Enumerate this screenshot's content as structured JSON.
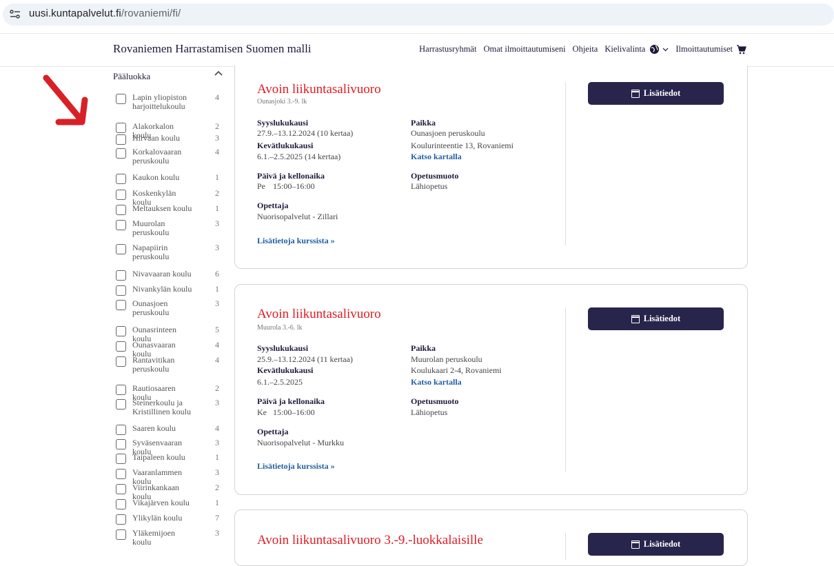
{
  "browser": {
    "url_host": "uusi.kuntapalvelut.fi",
    "url_path": "/rovaniemi/fi/"
  },
  "header": {
    "brand": "Rovaniemen Harrastamisen Suomen malli",
    "nav": {
      "groups": "Harrastusryhmät",
      "my": "Omat ilmoittautumiseni",
      "help": "Ohjeita",
      "lang": "Kielivalinta",
      "cart": "Ilmoittautumiset"
    }
  },
  "sidebar": {
    "heading": "Pääluokka",
    "items": [
      {
        "label": "Lapin yliopiston harjoittelukoulu",
        "count": "4"
      },
      {
        "label": "Alakorkalon koulu",
        "count": "2"
      },
      {
        "label": "Hirvaan koulu",
        "count": "3"
      },
      {
        "label": "Korkalovaaran peruskoulu",
        "count": "4"
      },
      {
        "label": "Kaukon koulu",
        "count": "1"
      },
      {
        "label": "Koskenkylän koulu",
        "count": "2"
      },
      {
        "label": "Meltauksen koulu",
        "count": "1"
      },
      {
        "label": "Muurolan peruskoulu",
        "count": "3"
      },
      {
        "label": "Napapiirin peruskoulu",
        "count": "3"
      },
      {
        "label": "Nivavaaran koulu",
        "count": "6"
      },
      {
        "label": "Nivankylän koulu",
        "count": "1"
      },
      {
        "label": "Ounasjoen peruskoulu",
        "count": "3"
      },
      {
        "label": "Ounasrinteen koulu",
        "count": "5"
      },
      {
        "label": "Ounasvaaran koulu",
        "count": "4"
      },
      {
        "label": "Rantavitikan peruskoulu",
        "count": "4"
      },
      {
        "label": "Rautiosaaren koulu",
        "count": "2"
      },
      {
        "label": "Steinerkoulu ja Kristillinen koulu",
        "count": "3"
      },
      {
        "label": "Saaren koulu",
        "count": "4"
      },
      {
        "label": "Syväsenvaaran koulu",
        "count": "3"
      },
      {
        "label": "Taipaleen koulu",
        "count": "1"
      },
      {
        "label": "Vaaranlammen koulu",
        "count": "3"
      },
      {
        "label": "Viirinkankaan koulu",
        "count": "2"
      },
      {
        "label": "Vikajärven koulu",
        "count": "1"
      },
      {
        "label": "Ylikylän koulu",
        "count": "7"
      },
      {
        "label": "Yläkemijoen koulu",
        "count": "3"
      }
    ]
  },
  "labels": {
    "autumn": "Syyslukukausi",
    "spring": "Kevätlukukausi",
    "daytime": "Päivä ja kellonaika",
    "teacher": "Opettaja",
    "place": "Paikka",
    "map": "Katso kartalla",
    "mode": "Opetusmuoto",
    "more": "Lisätietoja kurssista »",
    "button": "Lisätiedot"
  },
  "courses": [
    {
      "title": "Avoin liikuntasalivuoro",
      "subtitle": "Ounasjoki 3.-9. lk",
      "autumn": "27.9.–13.12.2024 (10 kertaa)",
      "spring": "6.1.–2.5.2025 (14 kertaa)",
      "day": "Pe",
      "time": "15:00–16:00",
      "teacher": "Nuorisopalvelut - Zillari",
      "place_name": "Ounasjoen peruskoulu",
      "place_address": "Koulurinteentie 13, Rovaniemi",
      "mode": "Lähiopetus"
    },
    {
      "title": "Avoin liikuntasalivuoro",
      "subtitle": "Muurola 3.-6. lk",
      "autumn": "25.9.–13.12.2024 (11 kertaa)",
      "spring": "6.1.–2.5.2025",
      "day": "Ke",
      "time": "15:00–16:00",
      "teacher": "Nuorisopalvelut - Murkku",
      "place_name": "Muurolan peruskoulu",
      "place_address": "Koulukaari 2-4, Rovaniemi",
      "mode": "Lähiopetus"
    },
    {
      "title": "Avoin liikuntasalivuoro 3.-9.-luokkalaisille"
    }
  ],
  "colors": {
    "accent_red": "#e11b22",
    "button_navy": "#28254d",
    "link_blue": "#1f5fa0",
    "arrow_red": "#d92027"
  }
}
